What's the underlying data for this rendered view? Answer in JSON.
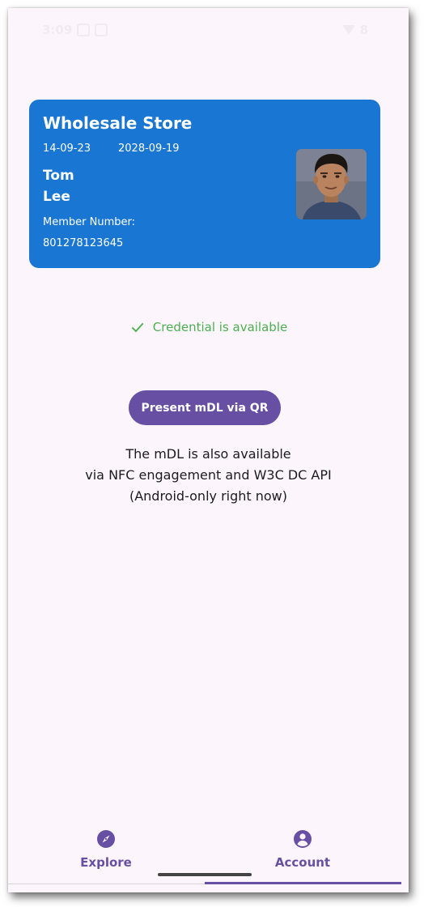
{
  "status_bar": {
    "time": "3:09",
    "battery_label": "8"
  },
  "card": {
    "title": "Wholesale Store",
    "issue_date": "14-09-23",
    "expiry_date": "2028-09-19",
    "first_name": "Tom",
    "last_name": "Lee",
    "member_label": "Member Number:",
    "member_number": "801278123645",
    "color": "#1976d2"
  },
  "credential": {
    "status_text": "Credential is available",
    "icon": "check-icon",
    "color": "#4caf50"
  },
  "present_button": {
    "label": "Present mDL via QR",
    "color": "#6750a4"
  },
  "info": {
    "line1": "The mDL is also available",
    "line2": "via NFC engagement and W3C DC API",
    "line3": "(Android-only right now)"
  },
  "bottom_nav": {
    "items": [
      {
        "label": "Explore",
        "icon": "compass-icon"
      },
      {
        "label": "Account",
        "icon": "account-circle-icon",
        "selected": true
      }
    ]
  }
}
